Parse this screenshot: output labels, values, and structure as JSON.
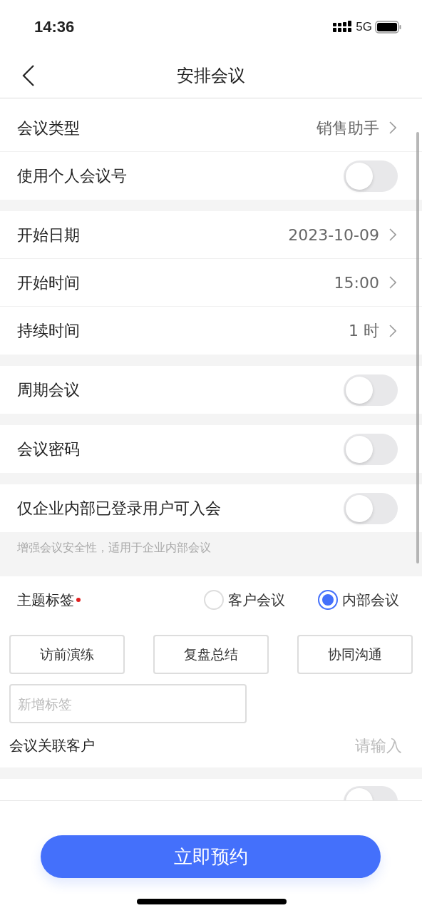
{
  "status_bar": {
    "time": "14:36",
    "network": "5G"
  },
  "header": {
    "title": "安排会议"
  },
  "sections": [
    {
      "rows": [
        {
          "kind": "link",
          "label": "会议类型",
          "value": "销售助手"
        },
        {
          "kind": "toggle",
          "label": "使用个人会议号",
          "on": false
        }
      ]
    },
    {
      "rows": [
        {
          "kind": "link",
          "label": "开始日期",
          "value": "2023-10-09"
        },
        {
          "kind": "link",
          "label": "开始时间",
          "value": "15:00"
        },
        {
          "kind": "link",
          "label": "持续时间",
          "value": "1 时"
        }
      ]
    },
    {
      "rows": [
        {
          "kind": "toggle",
          "label": "周期会议",
          "on": false
        }
      ]
    },
    {
      "rows": [
        {
          "kind": "toggle",
          "label": "会议密码",
          "on": false
        }
      ]
    },
    {
      "rows": [
        {
          "kind": "toggle",
          "label": "仅企业内部已登录用户可入会",
          "on": false
        }
      ],
      "hint": "增强会议安全性，适用于企业内部会议"
    }
  ],
  "topic_tags": {
    "label": "主题标签",
    "required": true,
    "options": [
      {
        "label": "客户会议",
        "selected": false
      },
      {
        "label": "内部会议",
        "selected": true
      }
    ],
    "tags": [
      "访前演练",
      "复盘总结",
      "协同沟通"
    ],
    "new_tag": {
      "placeholder": "新增标签"
    }
  },
  "linked_customer": {
    "label": "会议关联客户",
    "placeholder": "请输入"
  },
  "partial_row": {
    "on": false
  },
  "submit_button": "立即预约"
}
